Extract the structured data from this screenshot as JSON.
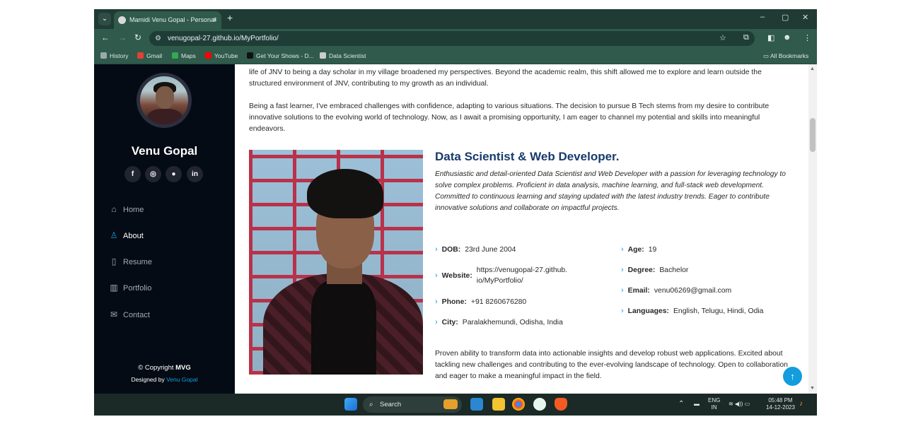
{
  "browser": {
    "tab_title": "Mamidi Venu Gopal - Personal",
    "tab_close": "×",
    "new_tab": "+",
    "url": "venugopal-27.github.io/MyPortfolio/",
    "window_controls": [
      "–",
      "▢",
      "✕"
    ],
    "bookmarks": [
      {
        "label": "History",
        "color": "#9aa"
      },
      {
        "label": "Gmail",
        "color": "#e34133"
      },
      {
        "label": "Maps",
        "color": "#34a853"
      },
      {
        "label": "YouTube",
        "color": "#ff0000"
      },
      {
        "label": "Get Your Shows - D...",
        "color": "#111111"
      },
      {
        "label": "Data Scientist",
        "color": "#cccccc"
      }
    ],
    "all_bookmarks": "All Bookmarks"
  },
  "sidebar": {
    "name": "Venu Gopal",
    "social": [
      {
        "icon": "facebook-icon",
        "glyph": "f"
      },
      {
        "icon": "instagram-icon",
        "glyph": "◎"
      },
      {
        "icon": "github-icon",
        "glyph": "●"
      },
      {
        "icon": "linkedin-icon",
        "glyph": "in"
      }
    ],
    "nav": [
      {
        "label": "Home",
        "icon": "home-icon",
        "glyph": "⌂",
        "active": false
      },
      {
        "label": "About",
        "icon": "person-icon",
        "glyph": "♙",
        "active": true
      },
      {
        "label": "Resume",
        "icon": "file-icon",
        "glyph": "▯",
        "active": false
      },
      {
        "label": "Portfolio",
        "icon": "book-icon",
        "glyph": "▥",
        "active": false
      },
      {
        "label": "Contact",
        "icon": "envelope-icon",
        "glyph": "✉",
        "active": false
      }
    ],
    "copyright_prefix": "© Copyright ",
    "copyright_brand": "MVG",
    "designed_prefix": "Designed by ",
    "designed_name": "Venu Gopal"
  },
  "main": {
    "para1": "life of JNV to being a day scholar in my village broadened my perspectives. Beyond the academic realm, this shift allowed me to explore and learn outside the structured environment of JNV, contributing to my growth as an individual.",
    "para2": "Being a fast learner, I've embraced challenges with confidence, adapting to various situations. The decision to pursue B Tech stems from my desire to contribute innovative solutions to the evolving world of technology. Now, as I await a promising opportunity, I am eager to channel my potential and skills into meaningful endeavors.",
    "role": "Data Scientist & Web Developer.",
    "role_desc": "Enthusiastic and detail-oriented Data Scientist and Web Developer with a passion for leveraging technology to solve complex problems. Proficient in data analysis, machine learning, and full-stack web development. Committed to continuous learning and staying updated with the latest industry trends. Eager to contribute innovative solutions and collaborate on impactful projects.",
    "info_left": [
      {
        "label": "DOB:",
        "value": "23rd June 2004"
      },
      {
        "label": "Website:",
        "value": "https://venugopal-27.github.io/MyPortfolio/"
      },
      {
        "label": "Phone:",
        "value": "+91 8260676280"
      },
      {
        "label": "City:",
        "value": "Paralakhemundi, Odisha, India"
      }
    ],
    "info_right": [
      {
        "label": "Age:",
        "value": "19"
      },
      {
        "label": "Degree:",
        "value": "Bachelor"
      },
      {
        "label": "Email:",
        "value": "venu06269@gmail.com"
      },
      {
        "label": "Languages:",
        "value": "English, Telugu, Hindi, Odia"
      }
    ],
    "closing": "Proven ability to transform data into actionable insights and develop robust web applications. Excited about tackling new challenges and contributing to the ever-evolving landscape of technology. Open to collaboration and eager to make a meaningful impact in the field.",
    "back_to_top": "↑"
  },
  "taskbar": {
    "search": "Search",
    "lang_top": "ENG",
    "lang_bottom": "IN",
    "time": "05:48 PM",
    "date": "14-12-2023"
  }
}
